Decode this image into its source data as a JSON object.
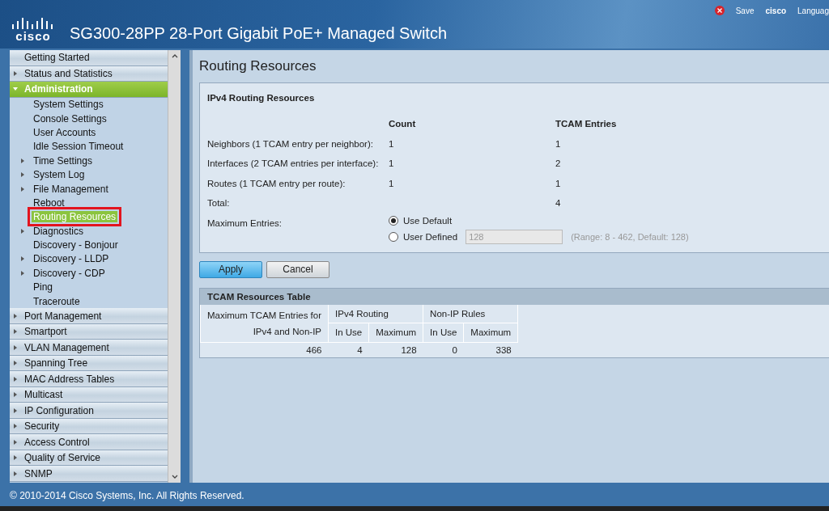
{
  "header": {
    "title": "SG300-28PP 28-Port Gigabit PoE+ Managed Switch",
    "logo_text": "cisco",
    "links": [
      "Save",
      "cisco",
      "Languag"
    ]
  },
  "sidebar": {
    "items": [
      {
        "label": "Getting Started",
        "kind": "page",
        "expanded": false
      },
      {
        "label": "Status and Statistics",
        "kind": "folder",
        "expanded": false
      },
      {
        "label": "Administration",
        "kind": "folder",
        "expanded": true,
        "children": [
          {
            "label": "System Settings",
            "kind": "page",
            "selected": false
          },
          {
            "label": "Console Settings",
            "kind": "page",
            "selected": false
          },
          {
            "label": "User Accounts",
            "kind": "page",
            "selected": false
          },
          {
            "label": "Idle Session Timeout",
            "kind": "page",
            "selected": false
          },
          {
            "label": "Time Settings",
            "kind": "folder",
            "selected": false
          },
          {
            "label": "System Log",
            "kind": "folder",
            "selected": false
          },
          {
            "label": "File Management",
            "kind": "folder",
            "selected": false
          },
          {
            "label": "Reboot",
            "kind": "page",
            "selected": false
          },
          {
            "label": "Routing Resources",
            "kind": "page",
            "selected": true
          },
          {
            "label": "Diagnostics",
            "kind": "folder",
            "selected": false
          },
          {
            "label": "Discovery - Bonjour",
            "kind": "page",
            "selected": false
          },
          {
            "label": "Discovery - LLDP",
            "kind": "folder",
            "selected": false
          },
          {
            "label": "Discovery - CDP",
            "kind": "folder",
            "selected": false
          },
          {
            "label": "Ping",
            "kind": "page",
            "selected": false
          },
          {
            "label": "Traceroute",
            "kind": "page",
            "selected": false
          }
        ]
      },
      {
        "label": "Port Management",
        "kind": "folder",
        "expanded": false
      },
      {
        "label": "Smartport",
        "kind": "folder",
        "expanded": false
      },
      {
        "label": "VLAN Management",
        "kind": "folder",
        "expanded": false
      },
      {
        "label": "Spanning Tree",
        "kind": "folder",
        "expanded": false
      },
      {
        "label": "MAC Address Tables",
        "kind": "folder",
        "expanded": false
      },
      {
        "label": "Multicast",
        "kind": "folder",
        "expanded": false
      },
      {
        "label": "IP Configuration",
        "kind": "folder",
        "expanded": false
      },
      {
        "label": "Security",
        "kind": "folder",
        "expanded": false
      },
      {
        "label": "Access Control",
        "kind": "folder",
        "expanded": false
      },
      {
        "label": "Quality of Service",
        "kind": "folder",
        "expanded": false
      },
      {
        "label": "SNMP",
        "kind": "folder",
        "expanded": false
      }
    ]
  },
  "page": {
    "title": "Routing Resources",
    "resources": {
      "title": "IPv4 Routing Resources",
      "columns": [
        "Count",
        "TCAM Entries"
      ],
      "rows": [
        {
          "label": "Neighbors (1 TCAM entry per neighbor):",
          "count": "1",
          "tcam": "1"
        },
        {
          "label": "Interfaces (2 TCAM entries per interface):",
          "count": "1",
          "tcam": "2"
        },
        {
          "label": "Routes (1 TCAM entry per route):",
          "count": "1",
          "tcam": "1"
        },
        {
          "label": "Total:",
          "tcam": "4"
        }
      ],
      "maximum": {
        "label": "Maximum Entries:",
        "options": [
          {
            "label": "Use Default",
            "selected": true
          },
          {
            "label": "User Defined",
            "selected": false
          }
        ],
        "value": "128",
        "disabled": true,
        "hint": "(Range: 8 - 462, Default: 128)"
      }
    },
    "buttons": [
      "Apply",
      "Cancel"
    ],
    "table": {
      "title": "TCAM Resources Table",
      "first_header": [
        "Maximum TCAM Entries for",
        "IPv4 and Non-IP"
      ],
      "groups": [
        {
          "label": "IPv4 Routing",
          "columns": [
            "In Use",
            "Maximum"
          ]
        },
        {
          "label": "Non-IP Rules",
          "columns": [
            "In Use",
            "Maximum"
          ]
        }
      ],
      "rows": [
        [
          "466",
          "4",
          "128",
          "0",
          "338"
        ]
      ]
    }
  },
  "footer": "© 2010-2014 Cisco Systems, Inc. All Rights Reserved."
}
